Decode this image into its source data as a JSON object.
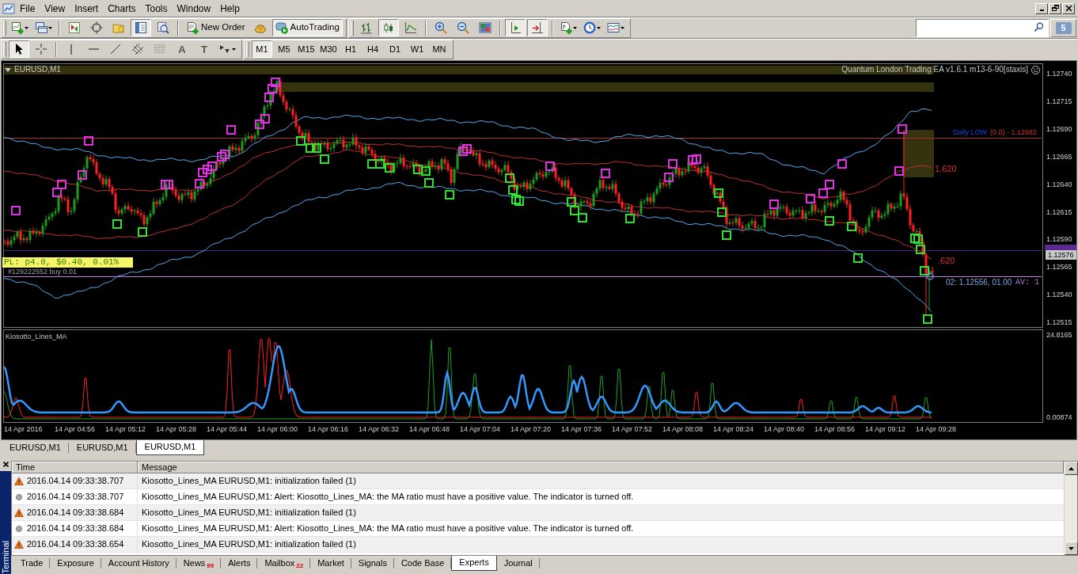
{
  "menu": [
    "File",
    "View",
    "Insert",
    "Charts",
    "Tools",
    "Window",
    "Help"
  ],
  "standard_toolbar": [
    [
      {
        "pressed": false
      },
      {
        "pressed": false
      }
    ],
    [
      {
        "pressed": false
      },
      {
        "pressed": false
      },
      {
        "pressed": false
      },
      {
        "pressed": true
      },
      {
        "pressed": false
      }
    ],
    [
      {
        "label": "New Order",
        "pressed": false
      },
      {
        "pressed": false
      },
      {
        "label": "AutoTrading",
        "pressed": true
      }
    ]
  ],
  "charts_toolbar": [
    [
      {
        "pressed": false
      },
      {
        "pressed": true
      },
      {
        "pressed": false
      }
    ],
    [
      {
        "pressed": false
      },
      {
        "pressed": false
      },
      {
        "pressed": false
      }
    ],
    [
      {
        "pressed": true
      },
      {
        "pressed": true
      }
    ],
    [
      {
        "pressed": false
      },
      {
        "pressed": false
      },
      {
        "pressed": false
      }
    ]
  ],
  "line_studies_toolbar": [
    [
      {
        "pressed": true
      },
      {
        "pressed": false
      }
    ],
    [
      {
        "pressed": false
      },
      {
        "pressed": false
      },
      {
        "pressed": false
      },
      {
        "pressed": false
      },
      {
        "pressed": false
      },
      {
        "label": "A",
        "pressed": false
      },
      {
        "label": "T",
        "pressed": false
      },
      {
        "pressed": false
      }
    ]
  ],
  "periodicity": [
    {
      "label": "M1",
      "selected": true
    },
    {
      "label": "M5",
      "selected": false
    },
    {
      "label": "M15",
      "selected": false
    },
    {
      "label": "M30",
      "selected": false
    },
    {
      "label": "H1",
      "selected": false
    },
    {
      "label": "H4",
      "selected": false
    },
    {
      "label": "D1",
      "selected": false
    },
    {
      "label": "W1",
      "selected": false
    },
    {
      "label": "MN",
      "selected": false
    }
  ],
  "messages": {
    "count": "5"
  },
  "chart": {
    "title": "EURUSD,M1",
    "expert": "Quantum London Trading EA v1.6.1 m13-6-90[staxis]",
    "price_axis": [
      "1.12740",
      "1.12715",
      "1.12690",
      "1.12665",
      "1.12640",
      "1.12615",
      "1.12590",
      "1.12565",
      "1.12540",
      "1.12515"
    ],
    "current_price": "1.12576",
    "daily_low": {
      "name": "Daily LOW",
      "value": "(0.0) - 1.12682"
    },
    "level_labels": [
      "1.620",
      ".620"
    ],
    "order_line": {
      "label": "02: 1.12556, 01.00",
      "average": "AV: 1"
    },
    "pl": "PL: p4.0, $0.40, 0.01%",
    "order": "#129222552 buy 0.01"
  },
  "indicator": {
    "name": "Kiosotto_Lines_MA",
    "axis": [
      "24.8165",
      "0.00874"
    ]
  },
  "time_axis": [
    "14 Apr 2016",
    "14 Apr 04:56",
    "14 Apr 05:12",
    "14 Apr 05:28",
    "14 Apr 05:44",
    "14 Apr 06:00",
    "14 Apr 06:16",
    "14 Apr 06:32",
    "14 Apr 06:48",
    "14 Apr 07:04",
    "14 Apr 07:20",
    "14 Apr 07:36",
    "14 Apr 07:52",
    "14 Apr 08:08",
    "14 Apr 08:24",
    "14 Apr 08:40",
    "14 Apr 08:56",
    "14 Apr 09:12",
    "14 Apr 09:28"
  ],
  "chart_tabs": [
    {
      "label": "EURUSD,M1",
      "selected": false
    },
    {
      "label": "EURUSD,M1",
      "selected": false
    },
    {
      "label": "EURUSD,M1",
      "selected": true
    }
  ],
  "terminal": {
    "title": "Terminal",
    "columns": [
      "Time",
      "Message"
    ],
    "rows": [
      {
        "kind": "error",
        "time": "2016.04.14 09:33:38.707",
        "message": "Kiosotto_Lines_MA EURUSD,M1: initialization failed (1)"
      },
      {
        "kind": "info",
        "time": "2016.04.14 09:33:38.707",
        "message": "Kiosotto_Lines_MA EURUSD,M1: Alert: Kiosotto_Lines_MA: the MA ratio must have a positive value. The indicator is turned off."
      },
      {
        "kind": "error",
        "time": "2016.04.14 09:33:38.684",
        "message": "Kiosotto_Lines_MA EURUSD,M1: initialization failed (1)"
      },
      {
        "kind": "info",
        "time": "2016.04.14 09:33:38.684",
        "message": "Kiosotto_Lines_MA EURUSD,M1: Alert: Kiosotto_Lines_MA: the MA ratio must have a positive value. The indicator is turned off."
      },
      {
        "kind": "error",
        "time": "2016.04.14 09:33:38.654",
        "message": "Kiosotto_Lines_MA EURUSD,M1: initialization failed (1)"
      }
    ],
    "tabs": [
      {
        "label": "Trade",
        "selected": false
      },
      {
        "label": "Exposure",
        "selected": false
      },
      {
        "label": "Account History",
        "selected": false
      },
      {
        "label": "News",
        "badge": "99",
        "selected": false
      },
      {
        "label": "Alerts",
        "selected": false
      },
      {
        "label": "Mailbox",
        "badge": "22",
        "selected": false
      },
      {
        "label": "Market",
        "selected": false
      },
      {
        "label": "Signals",
        "selected": false
      },
      {
        "label": "Code Base",
        "selected": false
      },
      {
        "label": "Experts",
        "selected": true
      },
      {
        "label": "Journal",
        "selected": false
      }
    ]
  }
}
